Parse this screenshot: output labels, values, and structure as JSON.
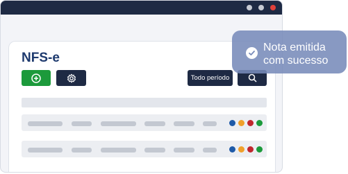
{
  "app": {
    "page_title": "NFS-e"
  },
  "toolbar": {
    "add_icon": "plus-circle-icon",
    "settings_icon": "gear-icon",
    "period_label": "Todo período",
    "search_icon": "search-icon"
  },
  "window_controls": {
    "colors": [
      "#c7cbd4",
      "#c7cbd4",
      "#e0413b"
    ]
  },
  "table": {
    "rows": [
      {
        "status_colors": [
          "#1e5aa8",
          "#f0a02a",
          "#c0262d",
          "#1c9a3b"
        ]
      },
      {
        "status_colors": [
          "#1e5aa8",
          "#f0a02a",
          "#c0262d",
          "#1c9a3b"
        ]
      }
    ]
  },
  "toast": {
    "icon": "check-circle-icon",
    "message": "Nota emitida com sucesso"
  },
  "colors": {
    "navy": "#1e2a44",
    "green": "#1c9a3b",
    "title": "#1e3a6e"
  }
}
